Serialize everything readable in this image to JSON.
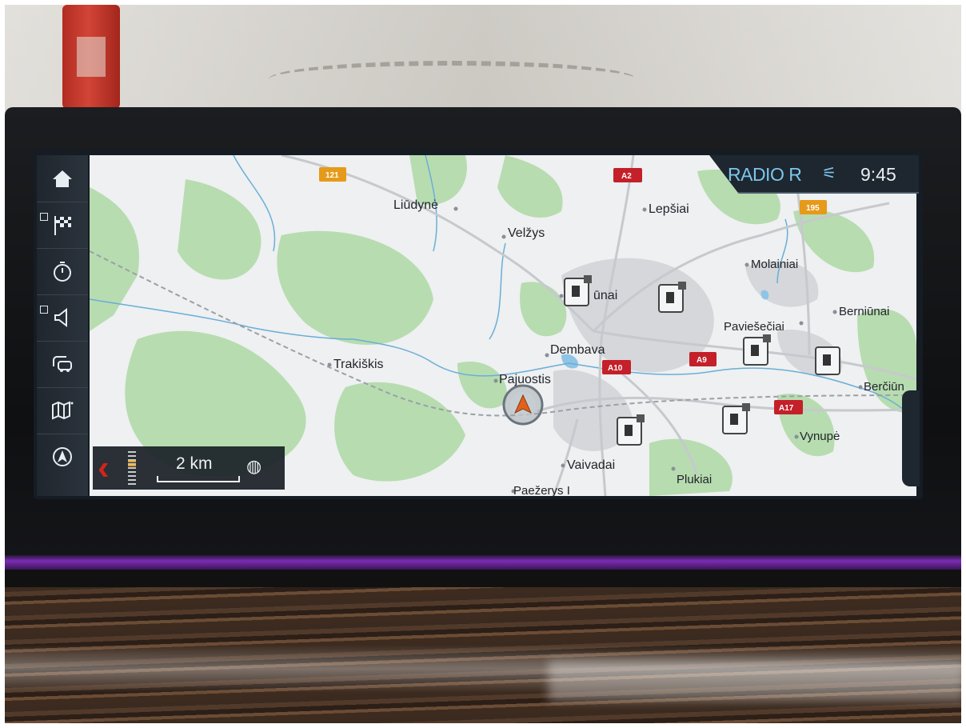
{
  "status": {
    "radio": "RADIO R",
    "mute_icon": "volume-muted-icon",
    "time": "9:45"
  },
  "sidebar": {
    "items": [
      {
        "icon": "home-icon",
        "checkbox": false
      },
      {
        "icon": "destination-flag-icon",
        "checkbox": true
      },
      {
        "icon": "timer-icon",
        "checkbox": false
      },
      {
        "icon": "speaker-icon",
        "checkbox": true
      },
      {
        "icon": "traffic-icon",
        "checkbox": false
      },
      {
        "icon": "map-info-icon",
        "checkbox": false
      },
      {
        "icon": "navigation-icon",
        "checkbox": false
      }
    ]
  },
  "scale": {
    "distance": "2 km",
    "north_icon": "compass-icon",
    "back_icon": "chevron-left-icon"
  },
  "map": {
    "places": [
      "Liūdynė",
      "Velžys",
      "Lepšiai",
      "Molainiai",
      "Berniūnai",
      "Paviešečiai",
      "ūnai",
      "Dembava",
      "Trakiškis",
      "Pajuostis",
      "Berčiūn",
      "Vynupė",
      "Vaivadai",
      "Plukiai",
      "Paežerys I"
    ],
    "roads": [
      "121",
      "A2",
      "195",
      "A10",
      "A9",
      "A17"
    ],
    "poi_icon": "fuel-station-icon",
    "vehicle_icon": "car-position-icon"
  }
}
